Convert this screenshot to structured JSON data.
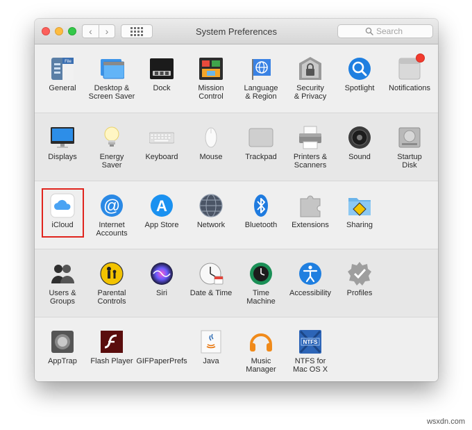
{
  "window": {
    "title": "System Preferences",
    "search_placeholder": "Search",
    "back_glyph": "‹",
    "forward_glyph": "›"
  },
  "colors": {
    "close": "#fc605c",
    "minimize": "#fdbc40",
    "zoom": "#34c84a",
    "highlight": "#e0241d",
    "notification_badge": "#f23b2e"
  },
  "rows": [
    [
      {
        "icon": "general-icon",
        "label": "General"
      },
      {
        "icon": "desktop-screensaver-icon",
        "label": "Desktop &\nScreen Saver"
      },
      {
        "icon": "dock-icon",
        "label": "Dock"
      },
      {
        "icon": "mission-control-icon",
        "label": "Mission\nControl"
      },
      {
        "icon": "language-region-icon",
        "label": "Language\n& Region"
      },
      {
        "icon": "security-privacy-icon",
        "label": "Security\n& Privacy"
      },
      {
        "icon": "spotlight-icon",
        "label": "Spotlight"
      },
      {
        "icon": "notifications-icon",
        "label": "Notifications"
      }
    ],
    [
      {
        "icon": "displays-icon",
        "label": "Displays"
      },
      {
        "icon": "energy-saver-icon",
        "label": "Energy\nSaver"
      },
      {
        "icon": "keyboard-icon",
        "label": "Keyboard"
      },
      {
        "icon": "mouse-icon",
        "label": "Mouse"
      },
      {
        "icon": "trackpad-icon",
        "label": "Trackpad"
      },
      {
        "icon": "printers-scanners-icon",
        "label": "Printers &\nScanners"
      },
      {
        "icon": "sound-icon",
        "label": "Sound"
      },
      {
        "icon": "startup-disk-icon",
        "label": "Startup\nDisk"
      }
    ],
    [
      {
        "icon": "icloud-icon",
        "label": "iCloud"
      },
      {
        "icon": "internet-accounts-icon",
        "label": "Internet\nAccounts"
      },
      {
        "icon": "app-store-icon",
        "label": "App Store"
      },
      {
        "icon": "network-icon",
        "label": "Network"
      },
      {
        "icon": "bluetooth-icon",
        "label": "Bluetooth"
      },
      {
        "icon": "extensions-icon",
        "label": "Extensions"
      },
      {
        "icon": "sharing-icon",
        "label": "Sharing"
      }
    ],
    [
      {
        "icon": "users-groups-icon",
        "label": "Users &\nGroups"
      },
      {
        "icon": "parental-controls-icon",
        "label": "Parental\nControls"
      },
      {
        "icon": "siri-icon",
        "label": "Siri"
      },
      {
        "icon": "date-time-icon",
        "label": "Date & Time"
      },
      {
        "icon": "time-machine-icon",
        "label": "Time\nMachine"
      },
      {
        "icon": "accessibility-icon",
        "label": "Accessibility"
      },
      {
        "icon": "profiles-icon",
        "label": "Profiles"
      }
    ],
    [
      {
        "icon": "apptrap-icon",
        "label": "AppTrap"
      },
      {
        "icon": "flash-player-icon",
        "label": "Flash Player"
      },
      {
        "icon": "gifpaperprefs-icon",
        "label": "GIFPaperPrefs"
      },
      {
        "icon": "java-icon",
        "label": "Java"
      },
      {
        "icon": "music-manager-icon",
        "label": "Music\nManager"
      },
      {
        "icon": "ntfs-mac-icon",
        "label": "NTFS for\nMac OS X"
      }
    ]
  ],
  "icon_text": {
    "general": "File",
    "ntfs": "NTFS",
    "app_store": "A"
  },
  "watermark": "wsxdn.com"
}
